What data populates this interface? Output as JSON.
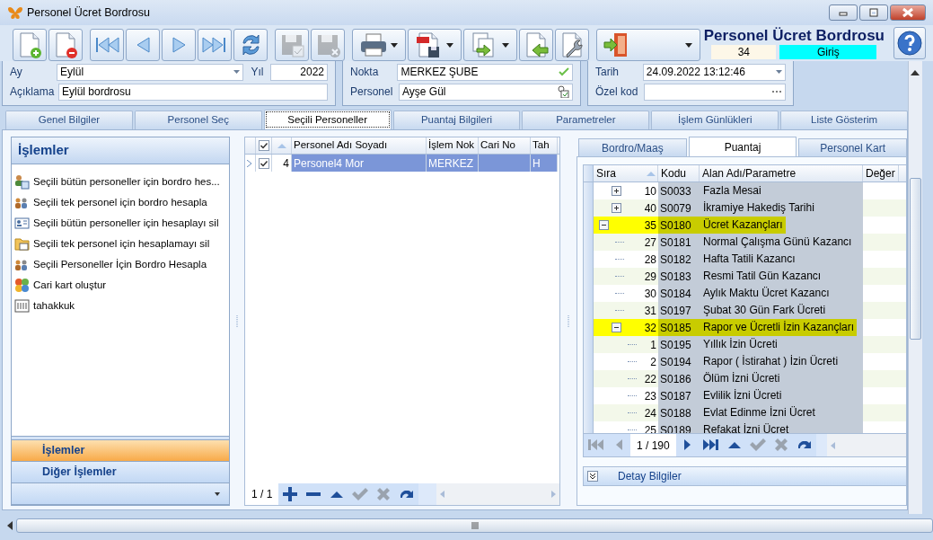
{
  "window": {
    "title": "Personel Ücret Bordrosu"
  },
  "toolbar": [
    {
      "kind": "new",
      "disabled": false,
      "dropdown": false
    },
    {
      "kind": "delete",
      "disabled": false,
      "dropdown": false
    },
    {
      "kind": "first",
      "disabled": false,
      "dropdown": false
    },
    {
      "kind": "prev",
      "disabled": false,
      "dropdown": false
    },
    {
      "kind": "next",
      "disabled": false,
      "dropdown": false
    },
    {
      "kind": "last",
      "disabled": false,
      "dropdown": false
    },
    {
      "kind": "refresh",
      "disabled": false,
      "dropdown": false
    },
    {
      "kind": "save",
      "disabled": true,
      "dropdown": false
    },
    {
      "kind": "discard",
      "disabled": true,
      "dropdown": false
    },
    {
      "kind": "print",
      "disabled": false,
      "dropdown": true
    },
    {
      "kind": "pdf",
      "disabled": false,
      "dropdown": true
    },
    {
      "kind": "export",
      "disabled": false,
      "dropdown": true
    },
    {
      "kind": "import",
      "disabled": false,
      "dropdown": false
    },
    {
      "kind": "settings",
      "disabled": false,
      "dropdown": false
    },
    {
      "kind": "exit",
      "disabled": false,
      "dropdown": true
    }
  ],
  "header": {
    "title": "Personel Ücret Bordrosu",
    "record_no": "34",
    "mode": "Giriş"
  },
  "form": {
    "groups": [
      {
        "rows": [
          [
            {
              "label": "Ay",
              "value": "Eylül",
              "kind": "dropdown"
            },
            {
              "label": "Yıl",
              "value": "2022",
              "kind": "number"
            }
          ],
          [
            {
              "label": "Açıklama",
              "value": "Eylül bordrosu",
              "kind": "text"
            }
          ]
        ]
      },
      {
        "rows": [
          [
            {
              "label": "Nokta",
              "value": "MERKEZ ŞUBE",
              "kind": "verified"
            }
          ],
          [
            {
              "label": "Personel",
              "value": "Ayşe Gül",
              "kind": "lookup"
            }
          ]
        ]
      },
      {
        "rows": [
          [
            {
              "label": "Tarih",
              "value": "24.09.2022 13:12:46",
              "kind": "dropdown"
            }
          ],
          [
            {
              "label": "Özel kod",
              "kind": "ellipsis"
            }
          ]
        ]
      }
    ]
  },
  "tabs": [
    {
      "label": "Genel Bilgiler",
      "selected": false
    },
    {
      "label": "Personel Seç",
      "selected": false
    },
    {
      "label": "Seçili Personeller",
      "selected": true
    },
    {
      "label": "Puantaj Bilgileri",
      "selected": false
    },
    {
      "label": "Parametreler",
      "selected": false
    },
    {
      "label": "İşlem Günlükleri",
      "selected": false
    },
    {
      "label": "Liste Gösterim",
      "selected": false
    }
  ],
  "operations_panel": {
    "title": "İşlemler",
    "items": [
      {
        "kind": "batch",
        "label": "Seçili bütün personeller için bordro hes..."
      },
      {
        "kind": "people",
        "label": "Seçili tek personel için bordro hesapla"
      },
      {
        "kind": "card",
        "label": "Seçili bütün personeller için hesaplayı sil"
      },
      {
        "kind": "folder",
        "label": "Seçili tek personel için hesaplamayı sil"
      },
      {
        "kind": "people",
        "label": "Seçili Personeller İçin Bordro Hesapla"
      },
      {
        "kind": "account",
        "label": "Cari kart oluştur"
      },
      {
        "kind": "accrual",
        "label": "tahakkuk"
      }
    ],
    "nav_groups": [
      {
        "label": "İşlemler",
        "selected": true
      },
      {
        "label": "Diğer İşlemler",
        "selected": false
      }
    ]
  },
  "personnel_grid": {
    "header_checked": true,
    "columns": [
      "Personel Adı Soyadı",
      "İşlem Nok",
      "Cari No",
      "Tah"
    ],
    "rows": [
      {
        "selected": true,
        "checked": true,
        "no": "4",
        "cells": [
          "Personel4 Mor",
          "MERKEZ",
          null,
          "H"
        ]
      }
    ],
    "pager": "1 / 1",
    "navigator": [
      {
        "kind": "add",
        "disabled": false
      },
      {
        "kind": "remove",
        "disabled": false
      },
      {
        "kind": "up",
        "disabled": false
      },
      {
        "kind": "check",
        "disabled": true
      },
      {
        "kind": "cancel",
        "disabled": true
      },
      {
        "kind": "redo",
        "disabled": false
      }
    ]
  },
  "detail_tabs": [
    {
      "label": "Bordro/Maaş",
      "selected": false
    },
    {
      "label": "Puantaj",
      "selected": true
    },
    {
      "label": "Personel Kart",
      "selected": false
    }
  ],
  "tree": {
    "columns": [
      "Sıra",
      "Kodu",
      "Alan Adı/Parametre",
      "Değer"
    ],
    "continued_rows": [
      {
        "order": "10",
        "code": "S0033",
        "name": "Fazla Mesai",
        "expanded": false,
        "highlighted": false
      },
      {
        "order": "40",
        "code": "S0079",
        "name": "İkramiye Hakediş Tarihi",
        "expanded": false,
        "highlighted": false
      }
    ],
    "rows": [
      {
        "order": "35",
        "code": "S0180",
        "name": "Ücret Kazançları",
        "expanded": true,
        "highlighted": true,
        "children": [
          {
            "order": "27",
            "code": "S0181",
            "name": "Normal Çalışma Günü Kazancı",
            "highlighted": false
          },
          {
            "order": "28",
            "code": "S0182",
            "name": "Hafta Tatili Kazancı",
            "highlighted": false
          },
          {
            "order": "29",
            "code": "S0183",
            "name": "Resmi Tatil Gün Kazancı",
            "highlighted": false
          },
          {
            "order": "30",
            "code": "S0184",
            "name": "Aylık Maktu Ücret Kazancı",
            "highlighted": false
          },
          {
            "order": "31",
            "code": "S0197",
            "name": "Şubat 30 Gün Fark Ücreti",
            "highlighted": false
          },
          {
            "order": "32",
            "code": "S0185",
            "name": "Rapor ve Ücretli İzin Kazançları",
            "expanded": true,
            "highlighted": true,
            "children": [
              {
                "order": "1",
                "code": "S0195",
                "name": "Yıllık İzin Ücreti",
                "highlighted": false
              },
              {
                "order": "2",
                "code": "S0194",
                "name": "Rapor ( İstirahat ) İzin Ücreti",
                "highlighted": false
              },
              {
                "order": "22",
                "code": "S0186",
                "name": "Ölüm İzni Ücreti",
                "highlighted": false
              },
              {
                "order": "23",
                "code": "S0187",
                "name": "Evlilik İzni Ücreti",
                "highlighted": false
              },
              {
                "order": "24",
                "code": "S0188",
                "name": "Evlat Edinme İzni Ücret",
                "highlighted": false
              },
              {
                "order": "25",
                "code": "S0189",
                "name": "Refakat İzni Ücret",
                "highlighted": false
              }
            ]
          }
        ]
      }
    ],
    "pager": "1 / 190",
    "navigator": [
      {
        "kind": "first",
        "disabled": true
      },
      {
        "kind": "prev",
        "disabled": true
      },
      {
        "kind": "pager"
      },
      {
        "kind": "next",
        "disabled": false
      },
      {
        "kind": "last",
        "disabled": false
      },
      {
        "kind": "up",
        "disabled": false
      },
      {
        "kind": "check",
        "disabled": true
      },
      {
        "kind": "cancel",
        "disabled": true
      },
      {
        "kind": "redo",
        "disabled": false
      }
    ]
  },
  "detail_section": {
    "label": "Detay Bilgiler",
    "expanded": false
  }
}
